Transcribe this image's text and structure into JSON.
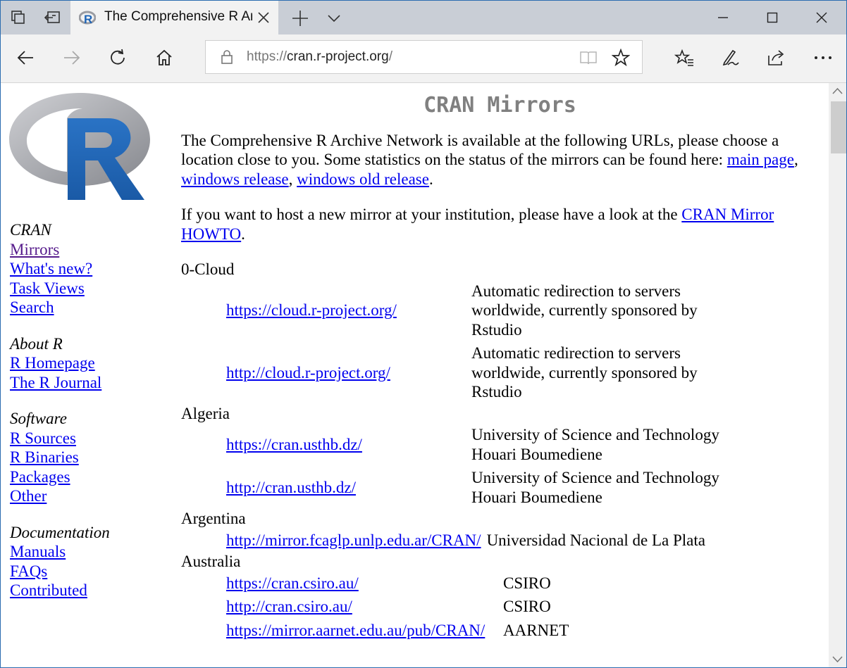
{
  "tab": {
    "title": "The Comprehensive R Archive Network",
    "favicon": "r-logo-icon"
  },
  "address": {
    "scheme": "https://",
    "host": "cran.r-project.org",
    "path": "/"
  },
  "sidebar": {
    "sections": [
      {
        "heading": "CRAN",
        "items": [
          "Mirrors",
          "What's new?",
          "Task Views",
          "Search"
        ]
      },
      {
        "heading": "About R",
        "items": [
          "R Homepage",
          "The R Journal"
        ]
      },
      {
        "heading": "Software",
        "items": [
          "R Sources",
          "R Binaries",
          "Packages",
          "Other"
        ]
      },
      {
        "heading": "Documentation",
        "items": [
          "Manuals",
          "FAQs",
          "Contributed"
        ]
      }
    ]
  },
  "main": {
    "title": "CRAN Mirrors",
    "intro_text": "The Comprehensive R Archive Network is available at the following URLs, please choose a location close to you. Some statistics on the status of the mirrors can be found here: ",
    "intro_links": [
      "main page",
      "windows release",
      "windows old release"
    ],
    "host_text": "If you want to host a new mirror at your institution, please have a look at the ",
    "host_link": "CRAN Mirror HOWTO",
    "countries": [
      {
        "name": "0-Cloud",
        "mirrors": [
          {
            "url": "https://cloud.r-project.org/",
            "desc": "Automatic redirection to servers worldwide, currently sponsored by Rstudio"
          },
          {
            "url": "http://cloud.r-project.org/",
            "desc": "Automatic redirection to servers worldwide, currently sponsored by Rstudio"
          }
        ]
      },
      {
        "name": "Algeria",
        "mirrors": [
          {
            "url": "https://cran.usthb.dz/",
            "desc": "University of Science and Technology Houari Boumediene"
          },
          {
            "url": "http://cran.usthb.dz/",
            "desc": "University of Science and Technology Houari Boumediene"
          }
        ]
      },
      {
        "name": "Argentina",
        "mirrors": [
          {
            "url": "http://mirror.fcaglp.unlp.edu.ar/CRAN/",
            "desc": "Universidad Nacional de La Plata"
          }
        ]
      },
      {
        "name": "Australia",
        "mirrors": [
          {
            "url": "https://cran.csiro.au/",
            "desc": "CSIRO"
          },
          {
            "url": "http://cran.csiro.au/",
            "desc": "CSIRO"
          },
          {
            "url": "https://mirror.aarnet.edu.au/pub/CRAN/",
            "desc": "AARNET"
          }
        ]
      }
    ]
  },
  "colors": {
    "link": "#0000ee",
    "visited": "#551a8b",
    "title": "#808080",
    "tabbar": "#c9ced6",
    "r_logo_blue": "#1f65b7",
    "r_logo_gray": "#9a9ca2"
  }
}
